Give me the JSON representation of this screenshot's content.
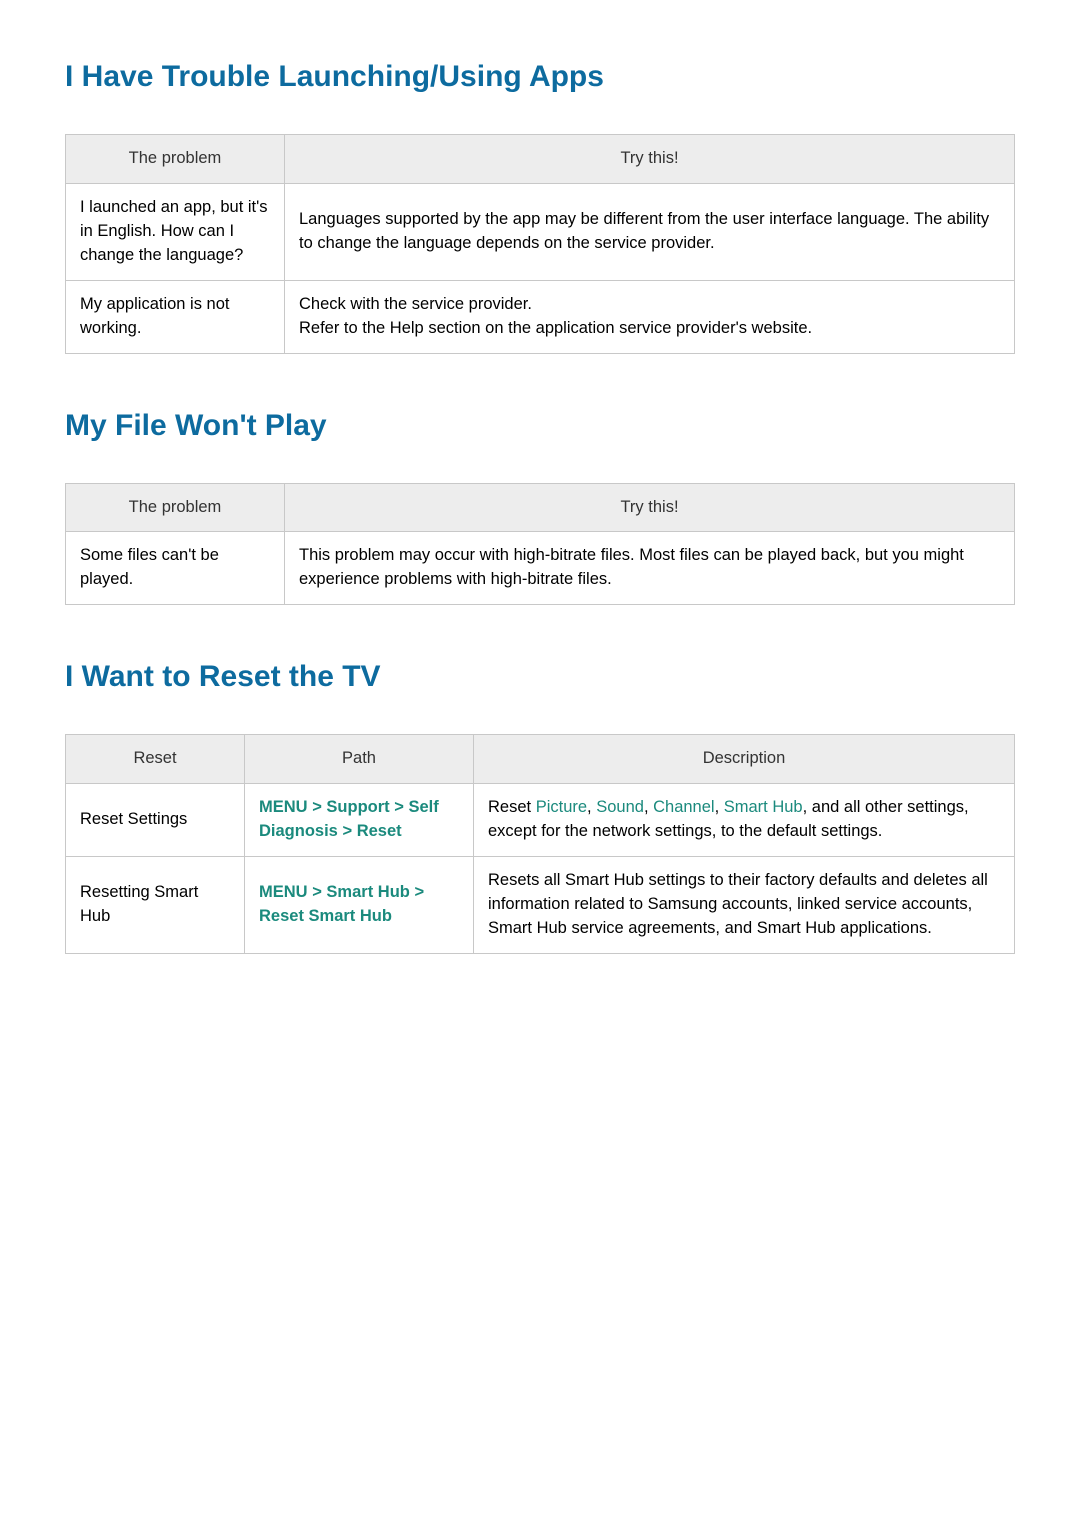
{
  "section1": {
    "title": "I Have Trouble Launching/Using Apps",
    "head_problem": "The problem",
    "head_try": "Try this!",
    "rows": [
      {
        "problem": "I launched an app, but it's in English. How can I change the language?",
        "try": "Languages supported by the app may be different from the user interface language. The ability to change the language depends on the service provider."
      },
      {
        "problem": "My application is not working.",
        "try": "Check with the service provider.\nRefer to the Help section on the application service provider's website."
      }
    ]
  },
  "section2": {
    "title": "My File Won't Play",
    "head_problem": "The problem",
    "head_try": "Try this!",
    "rows": [
      {
        "problem": "Some files can't be played.",
        "try": "This problem may occur with high-bitrate files. Most files can be played back, but you might experience problems with high-bitrate files."
      }
    ]
  },
  "section3": {
    "title": "I Want to Reset the TV",
    "head_reset": "Reset",
    "head_path": "Path",
    "head_desc": "Description",
    "rows": [
      {
        "reset": "Reset Settings",
        "path_parts": [
          "MENU",
          "Support",
          "Self Diagnosis",
          "Reset"
        ],
        "desc_pre": "Reset ",
        "desc_terms": [
          "Picture",
          "Sound",
          "Channel",
          "Smart Hub"
        ],
        "desc_post": ", and all other settings, except for the network settings, to the default settings."
      },
      {
        "reset": "Resetting Smart Hub",
        "path_parts": [
          "MENU",
          "Smart Hub",
          "Reset Smart Hub"
        ],
        "desc_full": "Resets all Smart Hub settings to their factory defaults and deletes all information related to Samsung accounts, linked service accounts, Smart Hub service agreements, and Smart Hub applications."
      }
    ]
  }
}
